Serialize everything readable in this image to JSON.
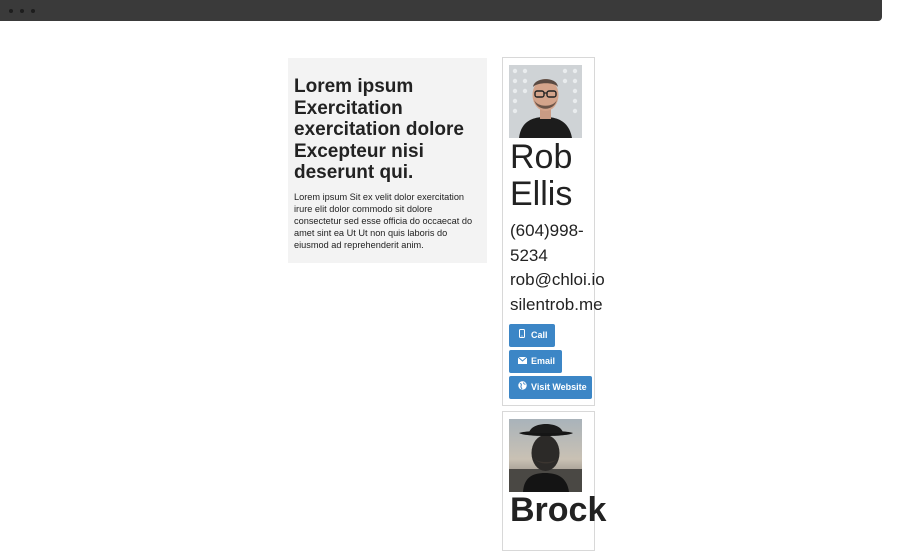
{
  "intro": {
    "heading": "Lorem ipsum Exercitation exercitation dolore Excepteur nisi deserunt qui.",
    "body": "Lorem ipsum Sit ex velit dolor exercitation irure elit dolor commodo sit dolore consectetur sed esse officia do occaecat do amet sint ea Ut Ut non quis laboris do eiusmod ad reprehenderit anim."
  },
  "cards": [
    {
      "name": "Rob Ellis",
      "phone": "(604)998-5234",
      "email": "rob@chloi.io",
      "website": "silentrob.me",
      "buttons": {
        "call": "Call",
        "email": "Email",
        "website": "Visit Website"
      },
      "icons": {
        "call": "mobile-phone-icon",
        "email": "envelope-icon",
        "website": "globe-icon"
      }
    },
    {
      "name": "Brock"
    }
  ],
  "colors": {
    "button": "#3c86c6",
    "titlebar": "#3a3a3a",
    "intro_bg": "#f3f3f3",
    "card_border": "#d8d8d8"
  }
}
